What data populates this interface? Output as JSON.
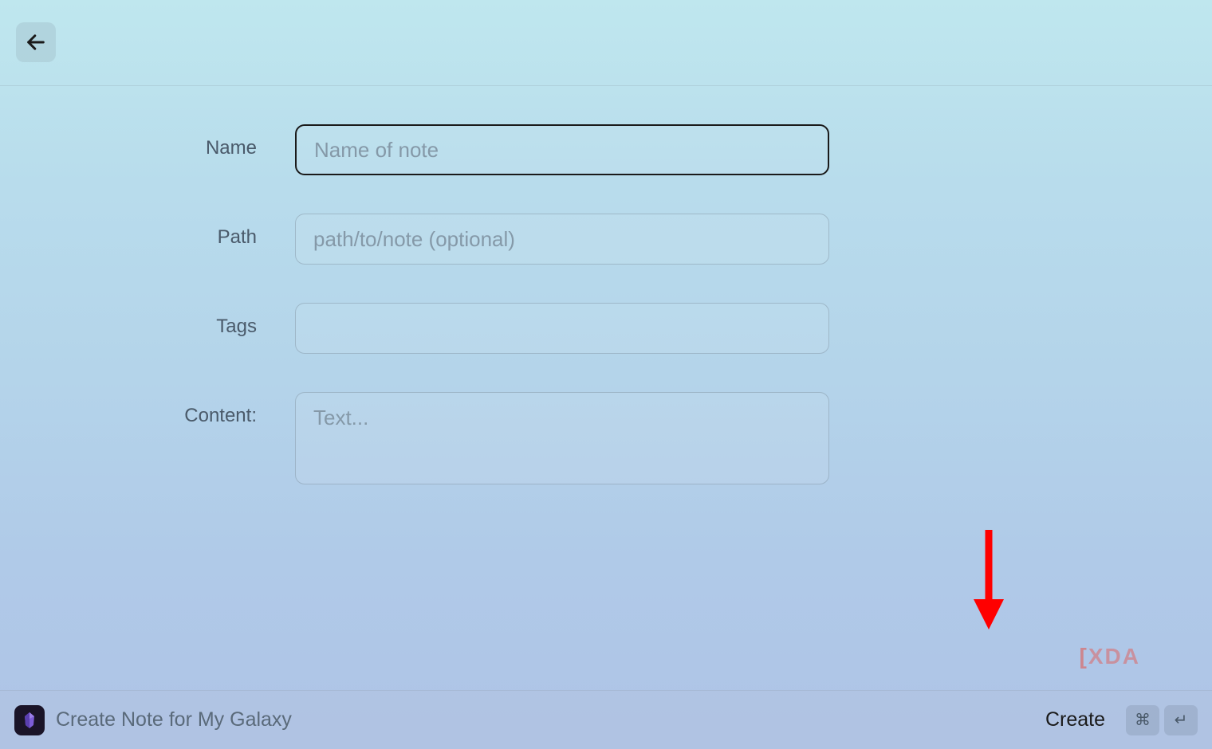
{
  "header": {
    "back_label": "Back"
  },
  "form": {
    "name": {
      "label": "Name",
      "placeholder": "Name of note",
      "value": ""
    },
    "path": {
      "label": "Path",
      "placeholder": "path/to/note (optional)",
      "value": ""
    },
    "tags": {
      "label": "Tags",
      "placeholder": "",
      "value": ""
    },
    "content": {
      "label": "Content:",
      "placeholder": "Text...",
      "value": ""
    }
  },
  "footer": {
    "app_name": "Obsidian",
    "title": "Create Note for My Galaxy",
    "create_button": "Create",
    "shortcut_cmd": "⌘",
    "shortcut_enter": "↵"
  },
  "watermark": "XDA"
}
